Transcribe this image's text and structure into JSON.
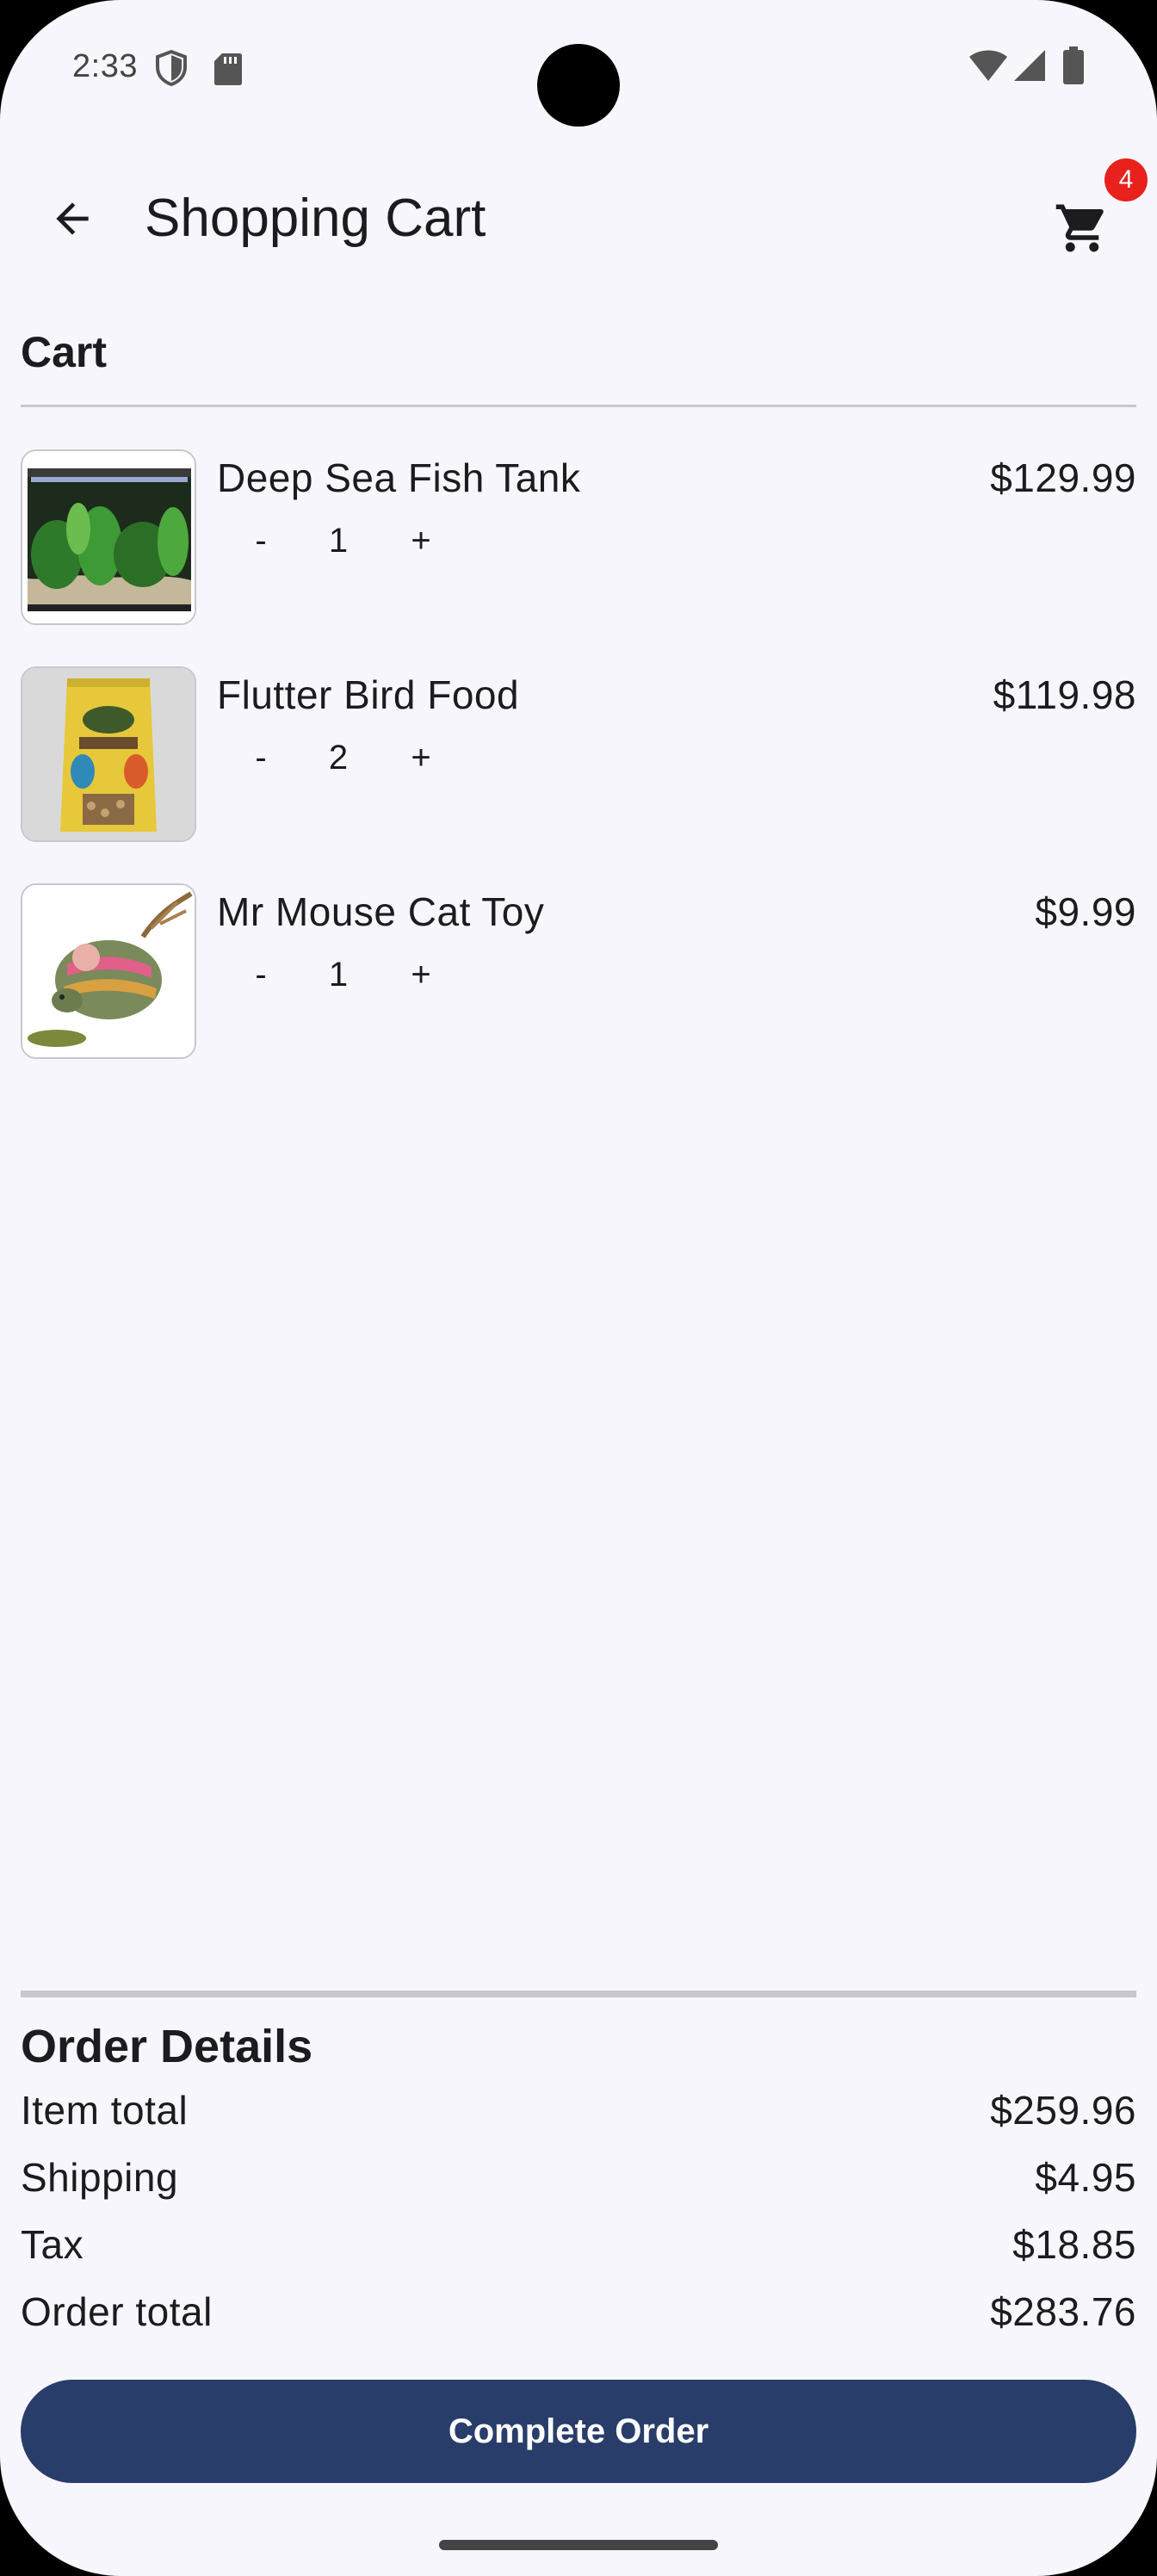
{
  "status_bar": {
    "time": "2:33",
    "icons": [
      "shield-icon",
      "sd-card-icon",
      "wifi-icon",
      "signal-icon",
      "battery-icon"
    ]
  },
  "app_bar": {
    "title": "Shopping Cart",
    "back_icon": "arrow-back-icon",
    "cart_icon": "shopping-cart-icon",
    "cart_badge": "4"
  },
  "cart": {
    "heading": "Cart",
    "items": [
      {
        "name": "Deep Sea Fish Tank",
        "price": "$129.99",
        "minus": "-",
        "quantity": "1",
        "plus": "+",
        "image": "fish-tank-image"
      },
      {
        "name": "Flutter Bird Food",
        "price": "$119.98",
        "minus": "-",
        "quantity": "2",
        "plus": "+",
        "image": "bird-food-image"
      },
      {
        "name": "Mr Mouse Cat Toy",
        "price": "$9.99",
        "minus": "-",
        "quantity": "1",
        "plus": "+",
        "image": "cat-toy-image"
      }
    ]
  },
  "order_details": {
    "heading": "Order Details",
    "rows": [
      {
        "label": "Item total",
        "value": "$259.96"
      },
      {
        "label": "Shipping",
        "value": "$4.95"
      },
      {
        "label": "Tax",
        "value": "$18.85"
      },
      {
        "label": "Order total",
        "value": "$283.76"
      }
    ],
    "button_label": "Complete Order"
  },
  "colors": {
    "background": "#f8f6fd",
    "button": "#293d6b",
    "badge": "#e8211d",
    "divider": "#c9c6cd",
    "text": "#1c1b1f"
  }
}
